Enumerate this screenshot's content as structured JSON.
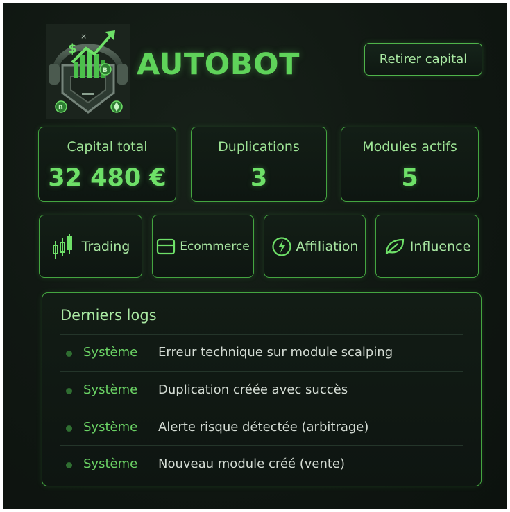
{
  "app": {
    "name": "AUTOBOT"
  },
  "header": {
    "withdraw_label": "Retirer capital"
  },
  "stats": [
    {
      "label": "Capital total",
      "value": "32 480 €"
    },
    {
      "label": "Duplications",
      "value": "3"
    },
    {
      "label": "Modules actifs",
      "value": "5"
    }
  ],
  "modules": [
    {
      "label": "Trading",
      "icon": "candlestick-chart-icon"
    },
    {
      "label": "Ecommerce",
      "icon": "card-icon"
    },
    {
      "label": "Affiliation",
      "icon": "lightning-icon"
    },
    {
      "label": "Influence",
      "icon": "leaf-icon"
    }
  ],
  "logs": {
    "title": "Derniers logs",
    "items": [
      {
        "source": "Système",
        "message": "Erreur technique sur module scalping"
      },
      {
        "source": "Système",
        "message": "Duplication créée avec succès"
      },
      {
        "source": "Système",
        "message": "Alerte risque détectée (arbitrage)"
      },
      {
        "source": "Système",
        "message": "Nouveau module créé (vente)"
      }
    ]
  },
  "colors": {
    "accent": "#5fd35a",
    "border": "#44a540",
    "background": "#101712"
  }
}
